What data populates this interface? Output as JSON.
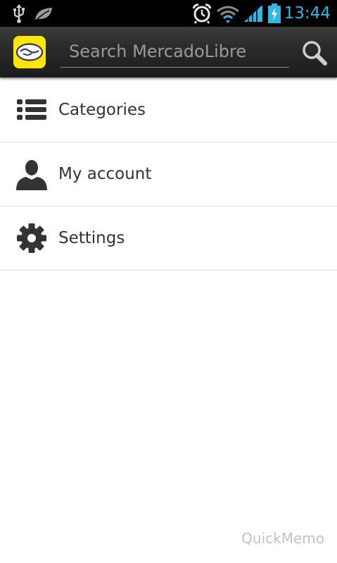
{
  "status_bar": {
    "time": "13:44",
    "icons": [
      "usb-icon",
      "leaf-icon",
      "alarm-icon",
      "wifi-icon",
      "signal-icon",
      "battery-charging-icon"
    ],
    "accent_color": "#33b5e5"
  },
  "action_bar": {
    "logo_icon": "mercadolibre-handshake-logo",
    "logo_color": "#ffe600",
    "search_placeholder": "Search MercadoLibre",
    "search_value": "",
    "search_icon": "magnifier-icon"
  },
  "menu": {
    "items": [
      {
        "label": "Categories",
        "icon": "list-icon"
      },
      {
        "label": "My account",
        "icon": "person-icon"
      },
      {
        "label": "Settings",
        "icon": "gear-icon"
      }
    ]
  },
  "watermark": "QuickMemo"
}
